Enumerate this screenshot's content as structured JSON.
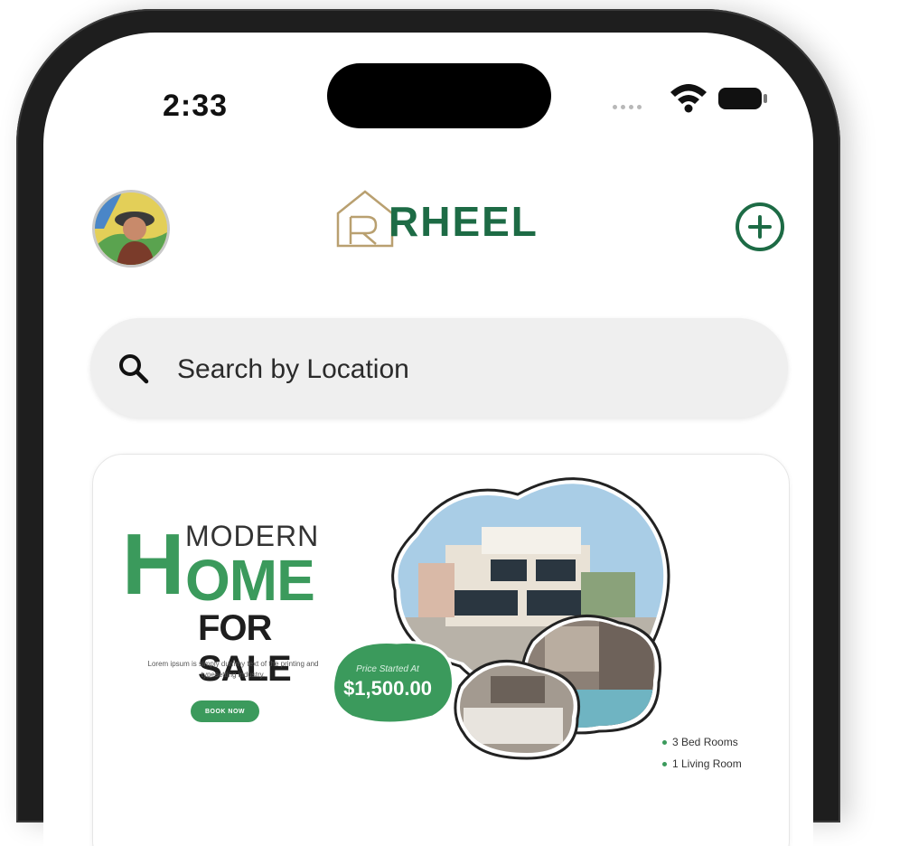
{
  "status_bar": {
    "time": "2:33"
  },
  "header": {
    "logo_text": "RHEEL",
    "add_icon": "plus-circle-icon",
    "accent_color": "#1d6b45"
  },
  "search": {
    "placeholder": "Search by Location",
    "icon": "search-icon"
  },
  "banner": {
    "headline_top": "MODERN",
    "headline_big_letter": "H",
    "headline_rest": "OME",
    "headline_bottom": "FOR SALE",
    "description": "Lorem ipsum is simply dummy text of the printing and typesetting industry.",
    "cta_label": "BOOK NOW",
    "price_caption": "Price Started At",
    "price": "$1,500.00",
    "features": [
      "3 Bed Rooms",
      "1 Living Room"
    ],
    "brand_color": "#3b9a5c"
  }
}
